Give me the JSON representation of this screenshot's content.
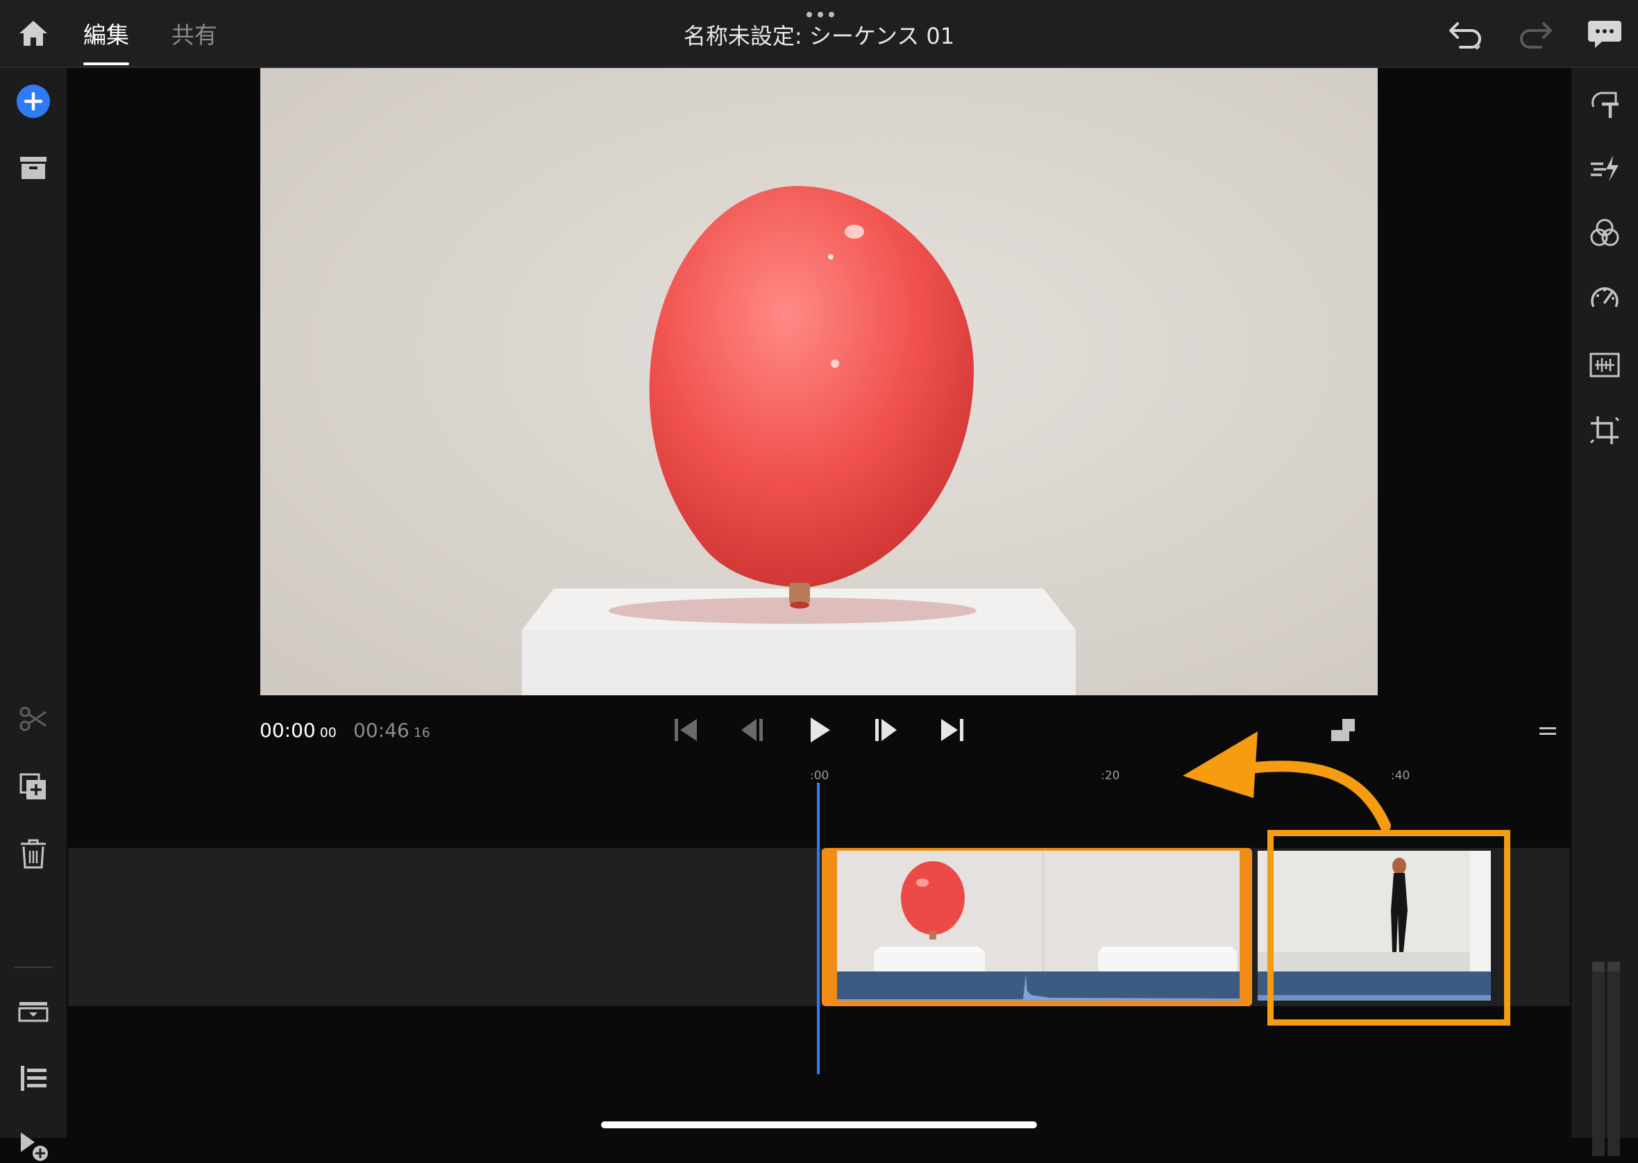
{
  "header": {
    "tabs": [
      {
        "label": "編集",
        "active": true
      },
      {
        "label": "共有",
        "active": false
      }
    ],
    "title": "名称未設定: シーケンス 01"
  },
  "left_sidebar": {
    "icons": [
      "add-media-icon",
      "project-panel-icon",
      "split-clip-icon",
      "duplicate-icon",
      "delete-icon",
      "clip-stack-icon",
      "track-list-icon",
      "add-clip-icon"
    ]
  },
  "right_sidebar": {
    "icons": [
      "text-icon",
      "transition-icon",
      "color-icon",
      "speed-icon",
      "audio-icon",
      "crop-icon"
    ]
  },
  "transport": {
    "current_time": "00:00",
    "current_frames": "00",
    "duration_time": "00:46",
    "duration_frames": "16"
  },
  "timeline": {
    "ruler_labels": [
      ":00",
      ":20",
      ":40"
    ]
  },
  "colors": {
    "accent_blue": "#2f7bf5",
    "clip_selected": "#f18c16",
    "annotation_orange": "#f59c11"
  }
}
